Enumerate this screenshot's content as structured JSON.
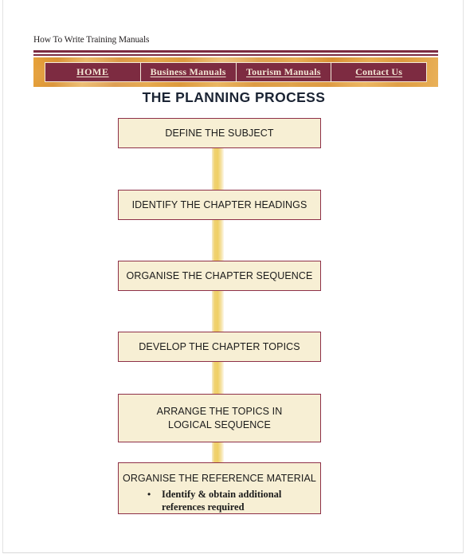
{
  "page": {
    "site_title": "How To Write Training Manuals"
  },
  "nav": {
    "items": [
      {
        "label": "HOME"
      },
      {
        "label": "Business Manuals"
      },
      {
        "label": "Tourism Manuals"
      },
      {
        "label": "Contact Us"
      }
    ]
  },
  "chart_data": {
    "type": "diagram",
    "title": "THE PLANNING PROCESS",
    "orientation": "vertical",
    "connector_color": "#efcf66",
    "node_fill": "#f7efd4",
    "node_border": "#8e3048",
    "nodes": [
      {
        "id": "n1",
        "lines": [
          "DEFINE THE SUBJECT"
        ],
        "bullets": []
      },
      {
        "id": "n2",
        "lines": [
          "IDENTIFY THE CHAPTER HEADINGS"
        ],
        "bullets": []
      },
      {
        "id": "n3",
        "lines": [
          "ORGANISE THE CHAPTER SEQUENCE"
        ],
        "bullets": []
      },
      {
        "id": "n4",
        "lines": [
          "DEVELOP THE CHAPTER TOPICS"
        ],
        "bullets": []
      },
      {
        "id": "n5",
        "lines": [
          "ARRANGE THE TOPICS IN",
          "LOGICAL SEQUENCE"
        ],
        "bullets": []
      },
      {
        "id": "n6",
        "lines": [
          "ORGANISE THE REFERENCE MATERIAL"
        ],
        "bullets": [
          "Identify & obtain additional",
          "references required"
        ]
      }
    ]
  },
  "nodes_text": {
    "n1_l1": "DEFINE THE SUBJECT",
    "n2_l1": "IDENTIFY THE CHAPTER HEADINGS",
    "n3_l1": "ORGANISE THE CHAPTER SEQUENCE",
    "n4_l1": "DEVELOP THE CHAPTER TOPICS",
    "n5_l1": "ARRANGE THE TOPICS IN",
    "n5_l2": "LOGICAL SEQUENCE",
    "n6_l1": "ORGANISE THE REFERENCE MATERIAL",
    "n6_b1": "Identify & obtain additional",
    "n6_b2": "references required",
    "bullet_glyph": "•"
  }
}
